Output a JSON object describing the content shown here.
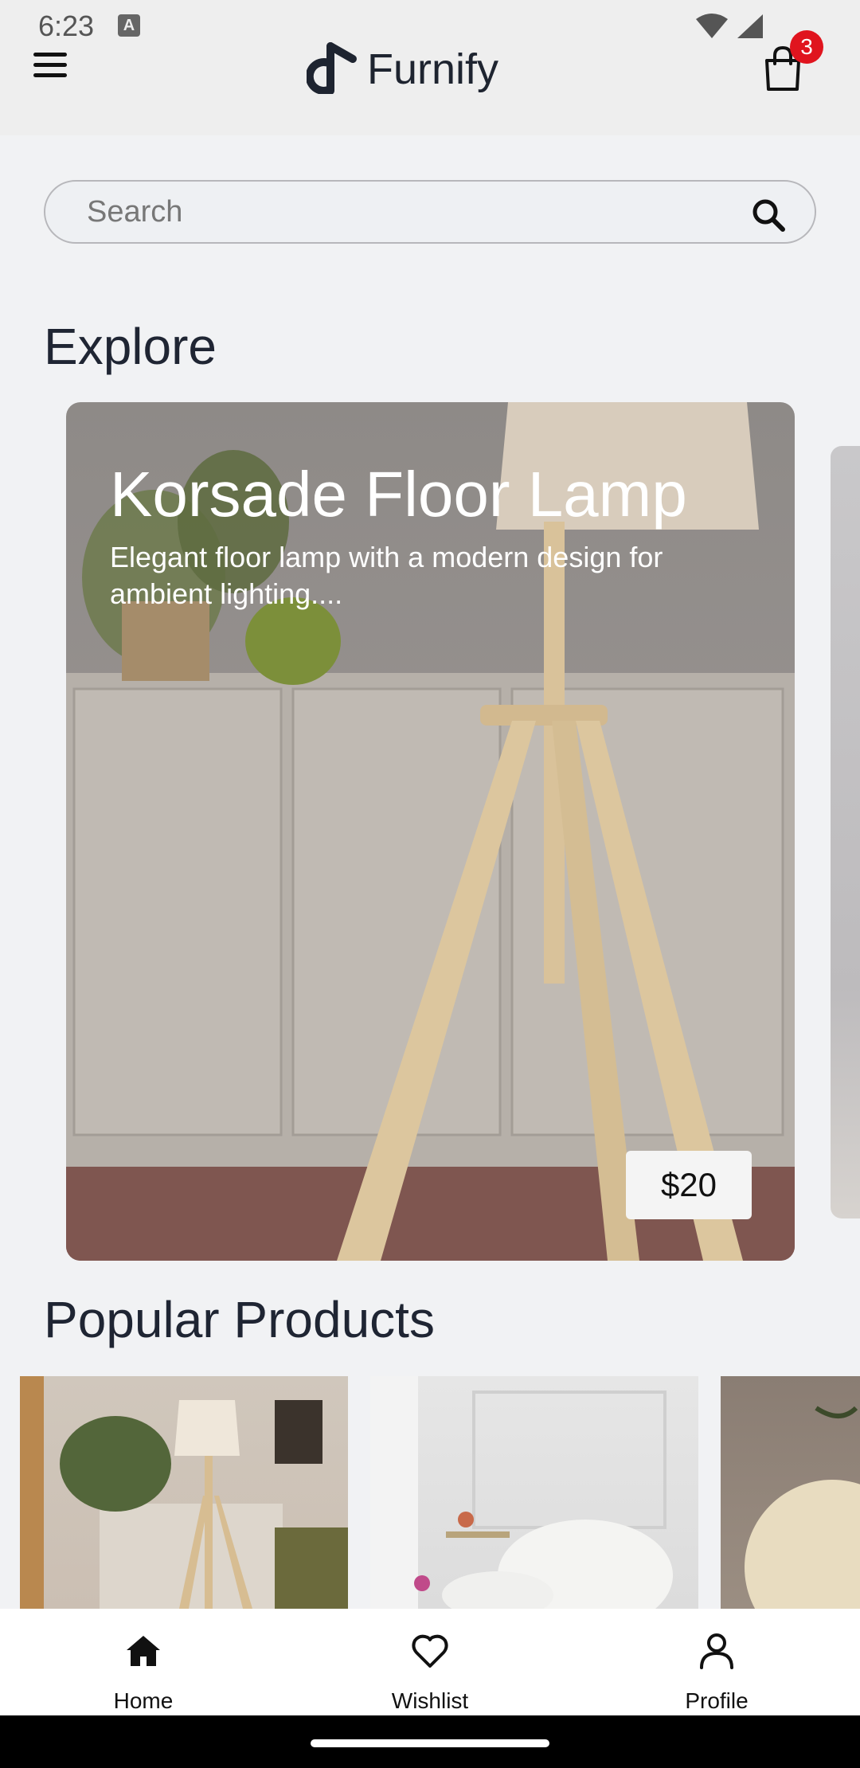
{
  "status_bar": {
    "time": "6:23",
    "notification_glyph": "A"
  },
  "header": {
    "app_name": "Furnify",
    "cart_count": "3"
  },
  "search": {
    "placeholder": "Search"
  },
  "explore": {
    "title": "Explore",
    "featured": {
      "name": "Korsade Floor Lamp",
      "description": "Elegant floor lamp with a modern design for ambient lighting....",
      "price": "$20"
    }
  },
  "popular": {
    "title": "Popular Products"
  },
  "bottom_nav": {
    "items": [
      {
        "label": "Home",
        "icon": "home-icon"
      },
      {
        "label": "Wishlist",
        "icon": "heart-icon"
      },
      {
        "label": "Profile",
        "icon": "person-icon"
      }
    ]
  },
  "colors": {
    "badge": "#e0141e",
    "text_dark": "#1f2533",
    "background": "#f1f2f4"
  }
}
